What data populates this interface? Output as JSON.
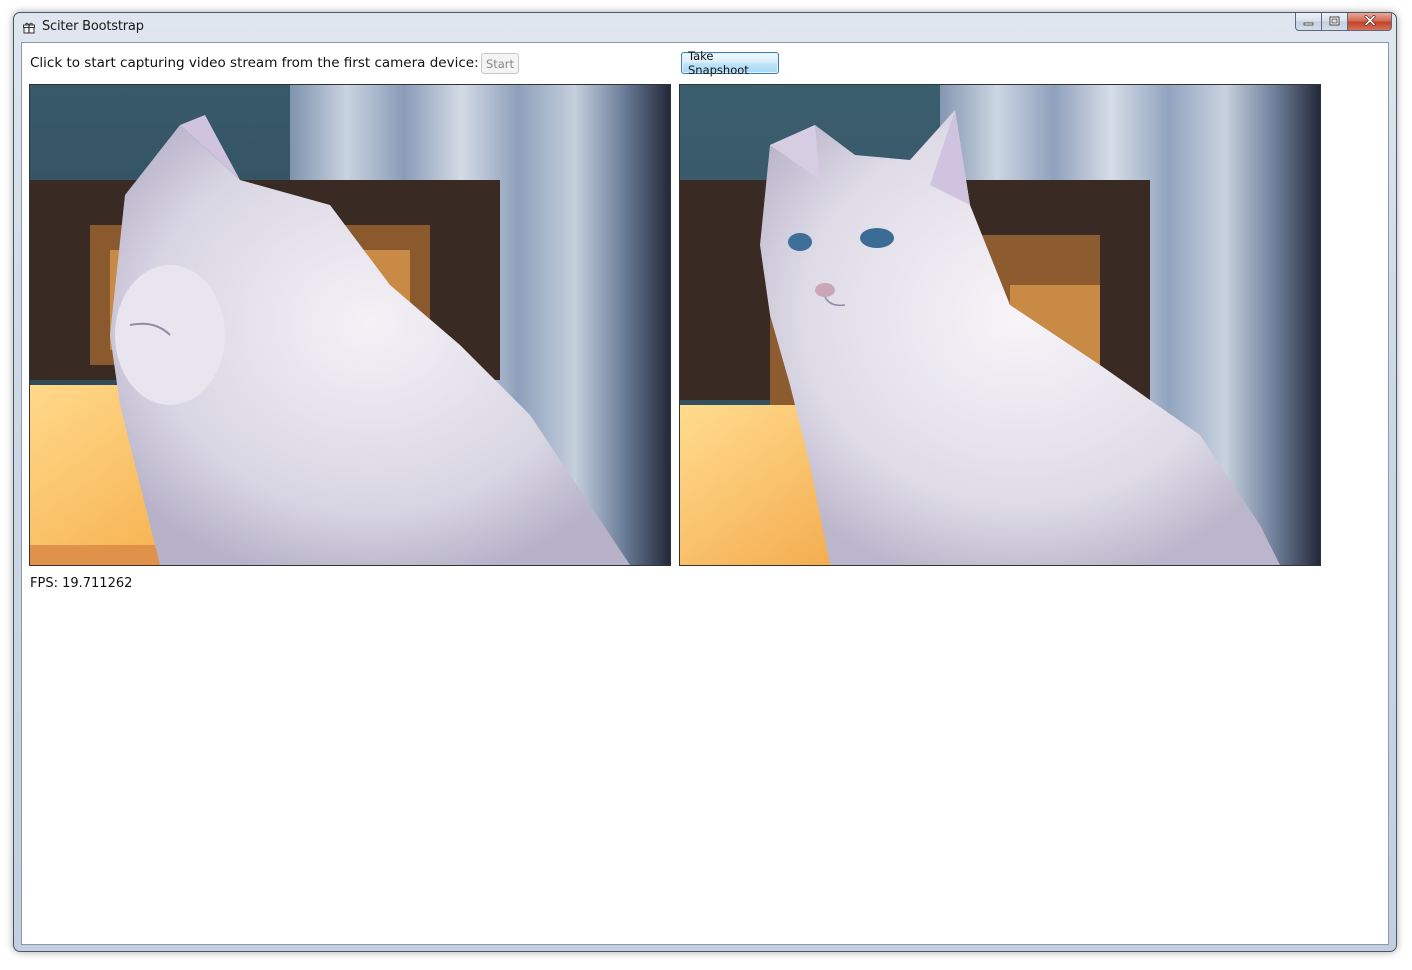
{
  "window": {
    "title": "Sciter Bootstrap",
    "icon": "app-gift-icon"
  },
  "caption_buttons": {
    "minimize_icon": "minimize-icon",
    "maximize_icon": "maximize-icon",
    "close_icon": "close-icon"
  },
  "toolbar": {
    "prompt": "Click to start capturing video stream from the first camera device:",
    "start_label": "Start",
    "start_enabled": false,
    "snapshot_label": "Take Snapshoot"
  },
  "video": {
    "live_view": "white cat, live camera stream",
    "snapshot_view": "white cat, captured snapshot"
  },
  "status": {
    "fps_label": "FPS:",
    "fps_value": "19.711262"
  }
}
